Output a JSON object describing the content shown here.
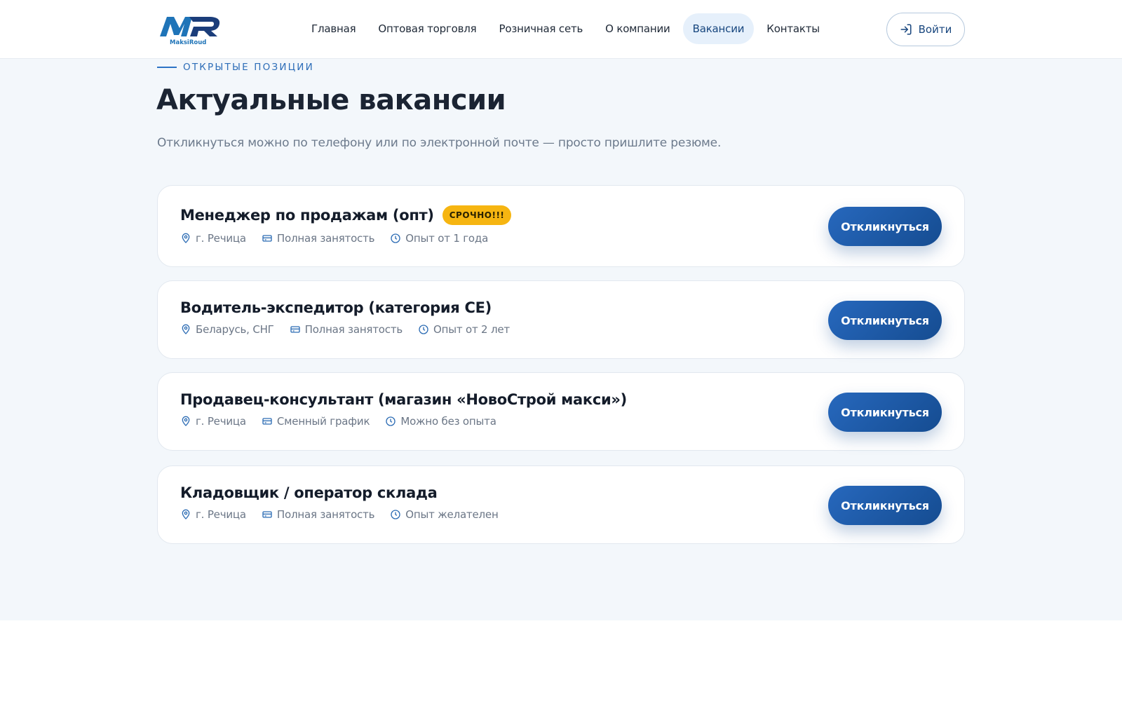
{
  "brand": {
    "logo_text": "MaksiRoud",
    "accent": "#1d5fae",
    "badge_color": "#f6b511"
  },
  "nav": {
    "items": [
      {
        "label": "Главная"
      },
      {
        "label": "Оптовая торговля"
      },
      {
        "label": "Розничная сеть"
      },
      {
        "label": "О компании"
      },
      {
        "label": "Вакансии",
        "active": true
      },
      {
        "label": "Контакты"
      }
    ],
    "login_label": "Войти",
    "login_icon": "login-icon"
  },
  "section": {
    "kicker": "ОТКРЫТЫЕ ПОЗИЦИИ",
    "title": "Актуальные вакансии",
    "subtitle": "Откликнуться можно по телефону или по электронной почте — просто пришлите резюме."
  },
  "jobs": [
    {
      "title": "Менеджер по продажам (опт)",
      "badge": "СРОЧНО!!!",
      "location": "г. Речица",
      "schedule": "Полная занятость",
      "experience": "Опыт от 1 года",
      "apply_label": "Откликнуться"
    },
    {
      "title": "Водитель-экспедитор (категория CE)",
      "location": "Беларусь, СНГ",
      "schedule": "Полная занятость",
      "experience": "Опыт от 2 лет",
      "apply_label": "Откликнуться"
    },
    {
      "title": "Продавец-консультант (магазин «НовоСтрой макси»)",
      "location": "г. Речица",
      "schedule": "Сменный график",
      "experience": "Можно без опыта",
      "apply_label": "Откликнуться"
    },
    {
      "title": "Кладовщик / оператор склада",
      "location": "г. Речица",
      "schedule": "Полная занятость",
      "experience": "Опыт желателен",
      "apply_label": "Откликнуться"
    }
  ]
}
